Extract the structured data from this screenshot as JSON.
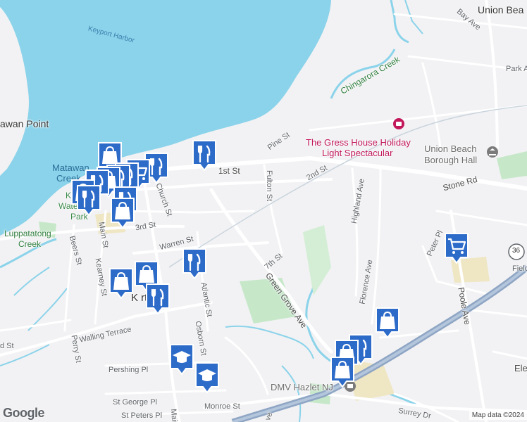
{
  "map": {
    "labels": {
      "union_beach_top": "Union Bea",
      "bay_ave": "Bay Ave",
      "park_ave": "Park A",
      "keyport_harbor": "Keyport Harbor",
      "chingarora_creek": "Chingarora Creek",
      "matawan_point": "awan Point",
      "pine_st": "Pine St",
      "gress_house_1": "The Gress House Holiday",
      "gress_house_2": "Light Spectacular",
      "union_beach_hall_1": "Union Beach",
      "union_beach_hall_2": "Borough Hall",
      "matawan_creek_1": "Matawan",
      "matawan_creek_2": "Creek",
      "first_st": "1st St",
      "second_st": "2nd St",
      "fulton_st": "Fulton St",
      "stone_rd": "Stone Rd",
      "church_st": "Church St",
      "highland_ave": "Highland Ave",
      "kw_1": "K",
      "kw_2": "Wate",
      "kw_3": "Park",
      "luppatatong_1": "Luppatatong",
      "luppatatong_2": "Creek",
      "third_st": "3rd St",
      "warren_st": "Warren St",
      "peter_pl": "Peter Pl",
      "route_36": "36",
      "field": "Fielo",
      "beers_st": "Beers St",
      "main_st": "Main St",
      "kearney_st": "Kearney St",
      "broad_st": "Dr",
      "seventh_st": "7th St",
      "florence_ave": "Florence Ave",
      "atlantic_st": "Atlantic St",
      "green_grove_ave": "Green Grove Ave",
      "keyport": "K          rt",
      "poole_ave": "Poole Ave",
      "walling_terrace": "Walling Terrace",
      "osborn_st": "Osborn St",
      "perry_st": "Perry St",
      "st_left": "d St",
      "ele": "Ele",
      "pershing_pl": "Pershing Pl",
      "dmv": "DMV Hazlet NJ",
      "st_george_pl": "St George Pl",
      "monroe_st": "Monroe St",
      "st_peters_pl": "St Peters Pl",
      "surrey_dr": "Surrey Dr",
      "ave_bottom": "ve",
      "main_bottom": "Mair"
    },
    "markers": [
      {
        "icon": "fork-knife-icon",
        "kind": "restaurant"
      },
      {
        "icon": "fork-knife-icon",
        "kind": "restaurant"
      },
      {
        "icon": "shopping-bag-icon",
        "kind": "shopping"
      },
      {
        "icon": "shopping-cart-icon",
        "kind": "grocery"
      },
      {
        "icon": "fork-knife-icon",
        "kind": "restaurant"
      },
      {
        "icon": "fork-knife-icon",
        "kind": "restaurant"
      },
      {
        "icon": "shopping-bag-icon",
        "kind": "shopping"
      },
      {
        "icon": "fork-knife-icon",
        "kind": "restaurant"
      },
      {
        "icon": "shopping-bag-icon",
        "kind": "shopping"
      },
      {
        "icon": "fork-knife-icon",
        "kind": "restaurant"
      },
      {
        "icon": "fork-knife-icon",
        "kind": "restaurant"
      },
      {
        "icon": "shopping-cart-icon",
        "kind": "grocery"
      },
      {
        "icon": "shopping-bag-icon",
        "kind": "shopping"
      },
      {
        "icon": "fork-knife-icon",
        "kind": "restaurant"
      },
      {
        "icon": "shopping-bag-icon",
        "kind": "shopping"
      },
      {
        "icon": "shopping-bag-icon",
        "kind": "shopping"
      },
      {
        "icon": "graduation-cap-icon",
        "kind": "school"
      },
      {
        "icon": "graduation-cap-icon",
        "kind": "school"
      }
    ],
    "colors": {
      "water": "#8bd3ea",
      "land": "#f2f2f4",
      "road": "#ffffff",
      "highway": "#8ea5c4",
      "park": "#c6e8c9",
      "marker_bg": "#2d6bc9",
      "marker_border": "#ffffff",
      "poi_pink": "#c2185b"
    },
    "logo": "Google",
    "attribution": "Map data ©2024"
  }
}
